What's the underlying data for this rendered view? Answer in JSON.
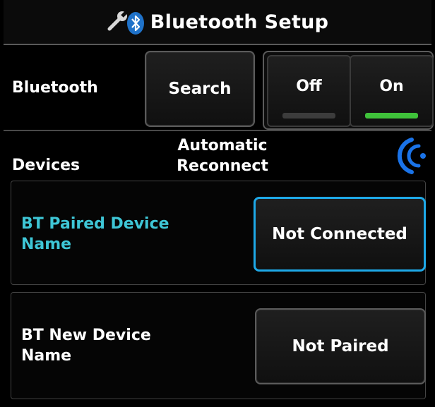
{
  "header": {
    "title": "Bluetooth Setup",
    "icons": [
      "wrench-icon",
      "bluetooth-icon"
    ]
  },
  "bluetooth_row": {
    "label": "Bluetooth",
    "search_label": "Search",
    "off_label": "Off",
    "on_label": "On",
    "state": "On",
    "on_indicator_color": "#3fc23a",
    "off_indicator_color": "#3c3c3c"
  },
  "devices_header": {
    "label": "Devices",
    "auto_reconnect_label": "Automatic Reconnect",
    "reconnect_icon": "signal-waves-icon",
    "icon_color": "#1a73e8"
  },
  "devices": [
    {
      "name": "BT Paired Device Name",
      "status": "Not Connected",
      "name_color": "#3ec6d6",
      "selected": true,
      "highlight_color": "#1ea9e8"
    },
    {
      "name": "BT New Device Name",
      "status": "Not Paired",
      "name_color": "#ffffff",
      "selected": false
    }
  ]
}
